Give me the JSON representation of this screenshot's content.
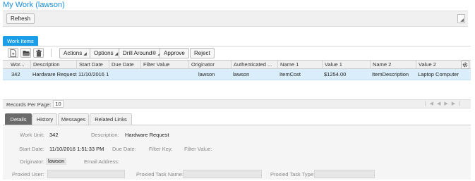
{
  "page": {
    "title": "My Work (lawson)"
  },
  "top_toolbar": {
    "refresh_label": "Refresh"
  },
  "tab": {
    "label": "Work Items"
  },
  "actions": {
    "actions_label": "Actions",
    "options_label": "Options",
    "drill_label": "Drill Around®",
    "approve_label": "Approve",
    "reject_label": "Reject"
  },
  "grid": {
    "columns": [
      "Wor...",
      "Description",
      "Start Date",
      "Due Date",
      "Filter Value",
      "Originator",
      "Authenticated ...",
      "Name 1",
      "Value 1",
      "Name 2",
      "Value 2"
    ],
    "rows": [
      {
        "cells": [
          "342",
          "Hardware Request",
          "11/10/2016 1",
          "",
          "",
          "lawson",
          "lawson",
          "ItemCost",
          "$1254.00",
          "ItemDescription",
          "Laptop Computer"
        ]
      }
    ]
  },
  "pager": {
    "records_label": "Records Per Page:",
    "records_value": "10"
  },
  "detail_tabs": [
    "Details",
    "History",
    "Messages",
    "Related Links"
  ],
  "details": {
    "work_unit_label": "Work Unit:",
    "work_unit_value": "342",
    "description_label": "Description:",
    "description_value": "Hardware Request",
    "start_date_label": "Start Date:",
    "start_date_value": "11/10/2016 1:51:33 PM",
    "due_date_label": "Due Date:",
    "filter_key_label": "Filter Key:",
    "filter_value_label": "Filter Value:",
    "originator_label": "Originator:",
    "originator_value": "lawson",
    "email_label": "Email Address:",
    "proxied_user_label": "Proxied User:",
    "proxied_task_name_label": "Proxied Task Name:",
    "proxied_task_type_label": "Proxied Task Type:"
  },
  "colors": {
    "accent": "#1a9ee8",
    "selected_row": "#d9eefa",
    "active_tab": "#6b6b6b"
  }
}
